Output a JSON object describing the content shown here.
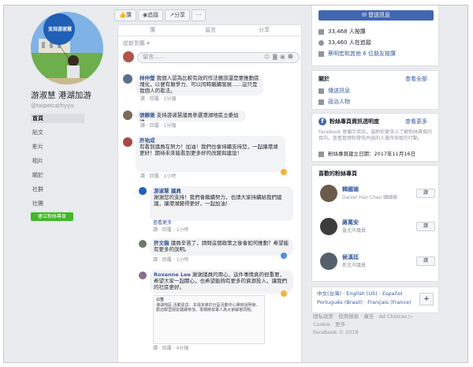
{
  "colors": {
    "brand": "#4267b2",
    "green": "#42b72a",
    "link": "#385898",
    "muted": "#90949c",
    "bg": "#e9ebee"
  },
  "profile": {
    "name": "游淑慧 港湖加游",
    "handle": "@taipeicathyyu",
    "balloon_text": "支持游淑慧"
  },
  "nav": {
    "items": [
      "首頁",
      "貼文",
      "影片",
      "相片",
      "關於",
      "社群",
      "社團"
    ],
    "create_page": "建立粉絲專頁"
  },
  "toolbar": {
    "like": "讚",
    "follow": "追蹤",
    "share": "分享",
    "more": "···"
  },
  "post": {
    "partial_actions": [
      "讚",
      "留言",
      "分享"
    ],
    "sort_label": "從新到舊 ▾",
    "comment_placeholder": "留言……",
    "comments": [
      {
        "name": "林仲瑩",
        "text": "我個人認為比較有效的作法應該還是要推動區塊化，以便有競爭力、可以同時繼續發展……這只是我個人的看法。",
        "time": "1分鐘",
        "actions": "讚 · 回覆"
      },
      {
        "name": "張靜雅",
        "text": "支持游淑慧議員參選港湖地區立委加油",
        "time": "1分鐘",
        "actions": "讚 · 回覆"
      },
      {
        "name": "許祐成",
        "text": "有看到議員在努力！加油！我們也會持續支持您，一起讓港湖更好！期待未來能看到更多好的改變與建設！",
        "time": "1小時",
        "actions": "讚 · 回覆"
      },
      {
        "name": "游淑慧 議員",
        "text": "謝謝您的支持！我們會繼續努力，也請大家持續給我們建議，讓港湖變得更好，一起加油！",
        "time": "1小時",
        "actions": "讚 · 回覆",
        "reply": "查看更多"
      },
      {
        "name": "許文龍",
        "text": "議員辛苦了，請問這個政策之後會如何推動？希望能有更多的說明。",
        "time": "1小時",
        "actions": "讚 · 回覆"
      },
      {
        "name": "Roxanne Lee",
        "text": "謝謝議員的用心，這件事情真的很重要，希望大家一起關心，也希望能夠有更多的資源投入，讓我們的社區更好。",
        "time": "1小時",
        "actions": "讚 · 回覆"
      },
      {
        "name": "公告",
        "text": "港湖地區 活動訊息：本週末將於社區活動中心舉辦說明會，歡迎鄰里朋友踴躍參加，現場將有專人為大家解答問題。",
        "time": "4分鐘",
        "actions": "讚 · 回覆"
      }
    ]
  },
  "right": {
    "send_message": "✉ 發送訊息",
    "stats": [
      "33,468 人按讚",
      "33,460 人在追蹤",
      "蔡明宏和其他 6 位朋友按讚"
    ],
    "about": {
      "title": "關於",
      "see_all": "查看全部",
      "items": [
        "傳送訊息",
        "政治人物"
      ]
    },
    "transparency": {
      "title": "粉絲專頁資訊透明度",
      "see_more": "查看更多",
      "desc": "Facebook 會顯示資訊，協助你更深入了解粉絲專頁的目的。查看管理和發布內容的人員所採取的行動。",
      "created": "粉絲專頁建立日期：2017年11月16日"
    },
    "liked": {
      "title": "喜歡的粉絲專頁",
      "pages": [
        {
          "name": "韓國瑜",
          "sub": "Daniel Han Chao 韓國瑜",
          "like": "讚"
        },
        {
          "name": "蔣萬安",
          "sub": "臺北市議員",
          "like": "讚"
        },
        {
          "name": "侯漢廷",
          "sub": "新北市議員",
          "like": "讚"
        }
      ]
    },
    "languages": {
      "line1": "中文(台灣) · English (US) · Español",
      "line2": "Português (Brasil) · Français (France)",
      "plus": "+"
    },
    "footer": {
      "line1": "隱私政策 · 使用條款 · 廣告 · Ad Choices ▷",
      "line2": "Cookie · 更多 ·",
      "line3": "Facebook © 2019"
    }
  }
}
